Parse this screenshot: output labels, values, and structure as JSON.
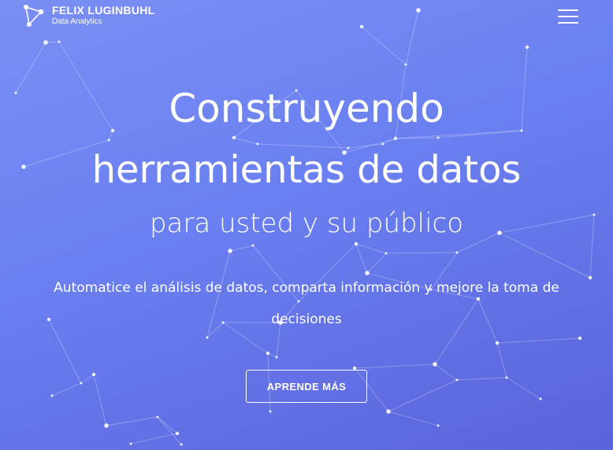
{
  "brand": {
    "name": "FELIX LUGINBUHL",
    "tagline": "Data Analytics",
    "logo_icon": "network-triangle-icon"
  },
  "nav": {
    "menu_icon": "hamburger-menu-icon"
  },
  "hero": {
    "title_line1": "Construyendo",
    "title_line2": "herramientas de datos",
    "subtitle": "para usted y su público",
    "description": "Automatice el análisis de datos, comparta información y mejore la toma de decisiones",
    "cta_label": "APRENDE MÁS"
  },
  "colors": {
    "background_start": "#7a8ff4",
    "background_end": "#5a63da",
    "text": "#ffffff"
  }
}
